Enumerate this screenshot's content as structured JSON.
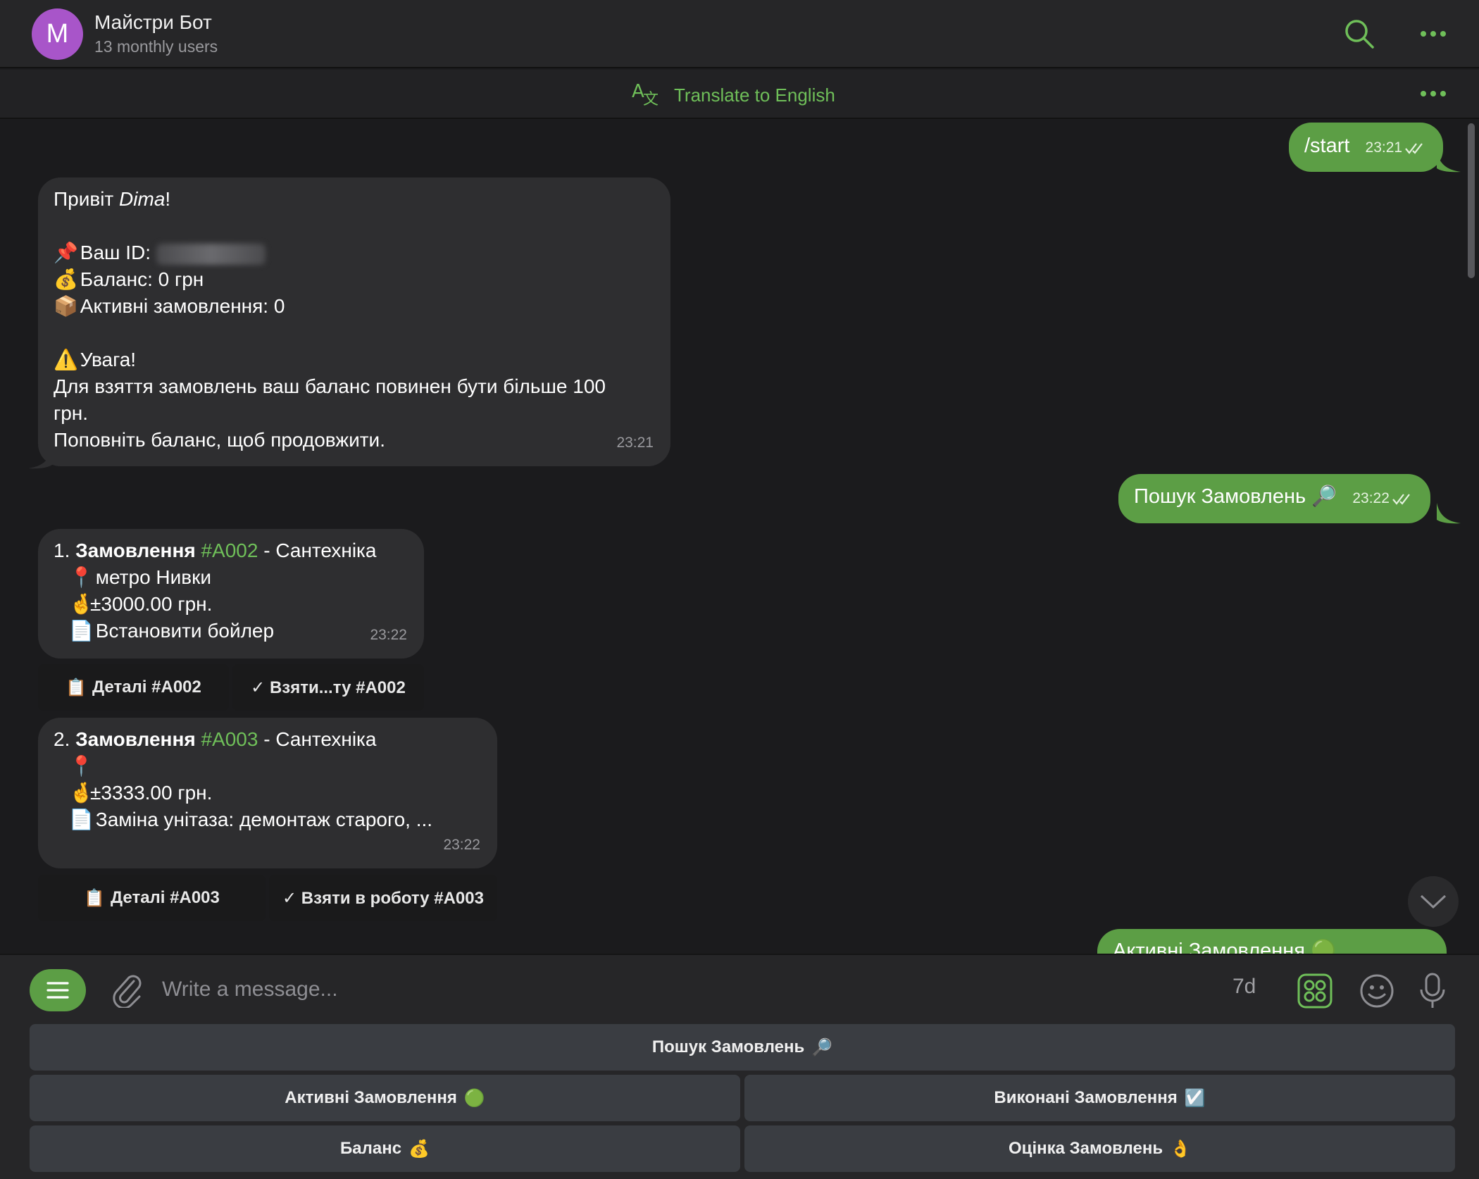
{
  "header": {
    "avatar_letter": "M",
    "name": "Майстри Бот",
    "subtitle": "13 monthly users",
    "search_icon": "search-icon",
    "more_icon": "more-icon"
  },
  "translate_bar": {
    "label": "Translate to English",
    "icon": "translate-icon"
  },
  "messages": {
    "start": {
      "text": "/start",
      "time": "23:21"
    },
    "welcome": {
      "greeting_prefix": "Привіт ",
      "greeting_name": "Dima",
      "greeting_suffix": "!",
      "id_label": "Ваш ID:",
      "balance": "Баланс: 0 грн",
      "active_orders": "Активні замовлення: 0",
      "warning_title": "Увага!",
      "warning_line1": "Для взяття замовлень ваш баланс повинен бути більше 100",
      "warning_line2": "грн.",
      "warning_line3": "Поповніть баланс, щоб продовжити.",
      "time": "23:21"
    },
    "search": {
      "text": "Пошук Замовлень",
      "emoji": "🔎",
      "time": "23:22"
    },
    "order1": {
      "num": "1.",
      "title": "Замовлення",
      "code": "#A002",
      "category": "- Сантехніка",
      "location": "метро Нивки",
      "price": "±3000.00 грн.",
      "desc": "Встановити бойлер",
      "time": "23:22",
      "btn_details": "Деталі #A002",
      "btn_take": "✓ Взяти...ту #A002"
    },
    "order2": {
      "num": "2.",
      "title": "Замовлення",
      "code": "#A003",
      "category": "- Сантехніка",
      "location": "",
      "price": "±3333.00 грн.",
      "desc": "Заміна унітаза: демонтаж старого, ...",
      "time": "23:22",
      "btn_details": "Деталі #A003",
      "btn_take": "✓ Взяти в роботу #A003"
    },
    "active_partial": {
      "text": "Активні Замовлення"
    }
  },
  "composer": {
    "placeholder": "Write a message...",
    "timer": "7d"
  },
  "keyboard": {
    "search": "Пошук Замовлень",
    "active": "Активні Замовлення",
    "done": "Виконані Замовлення",
    "balance": "Баланс",
    "rating": "Оцінка Замовлень"
  },
  "colors": {
    "accent": "#5c9e45",
    "accent_text": "#6fbf59",
    "avatar": "#a855c9",
    "bubble_in": "#2e2e30"
  }
}
